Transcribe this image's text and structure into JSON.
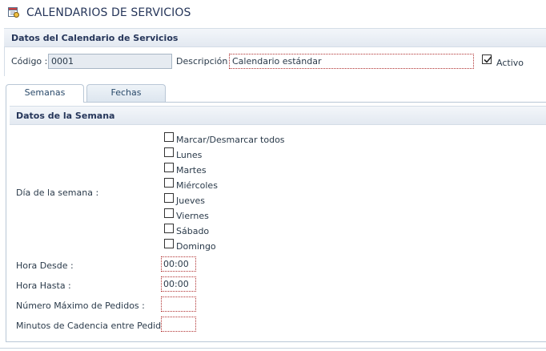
{
  "window": {
    "title": "CALENDARIOS DE SERVICIOS"
  },
  "datos_calendario": {
    "section_title": "Datos del Calendario de Servicios",
    "codigo_label": "Código :",
    "codigo_value": "0001",
    "descripcion_label": "Descripción :",
    "descripcion_value": "Calendario estándar",
    "activo_label": "Activo",
    "activo_checked": true
  },
  "tabs": [
    {
      "label": "Semanas",
      "active": true
    },
    {
      "label": "Fechas",
      "active": false
    }
  ],
  "datos_semana": {
    "section_title": "Datos de la Semana",
    "dia_label": "Día de la semana :",
    "checkboxes": [
      {
        "label": "Marcar/Desmarcar todos",
        "checked": false
      },
      {
        "label": "Lunes",
        "checked": false
      },
      {
        "label": "Martes",
        "checked": false
      },
      {
        "label": "Miércoles",
        "checked": false
      },
      {
        "label": "Jueves",
        "checked": false
      },
      {
        "label": "Viernes",
        "checked": false
      },
      {
        "label": "Sábado",
        "checked": false
      },
      {
        "label": "Domingo",
        "checked": false
      }
    ],
    "hora_desde_label": "Hora Desde :",
    "hora_desde_value": "00:00",
    "hora_hasta_label": "Hora Hasta :",
    "hora_hasta_value": "00:00",
    "num_max_label": "Número Máximo de Pedidos :",
    "num_max_value": "",
    "min_cadencia_label": "Minutos de Cadencia entre Pedidos :",
    "min_cadencia_value": ""
  },
  "icons": {
    "title_icon": "calendar-settings-icon",
    "checkbox_checked": "check-icon"
  },
  "colors": {
    "title_text": "#26365a",
    "header_bg": "#e3e9f1",
    "required_border": "#b03030",
    "readonly_bg": "#e6ebf1"
  }
}
